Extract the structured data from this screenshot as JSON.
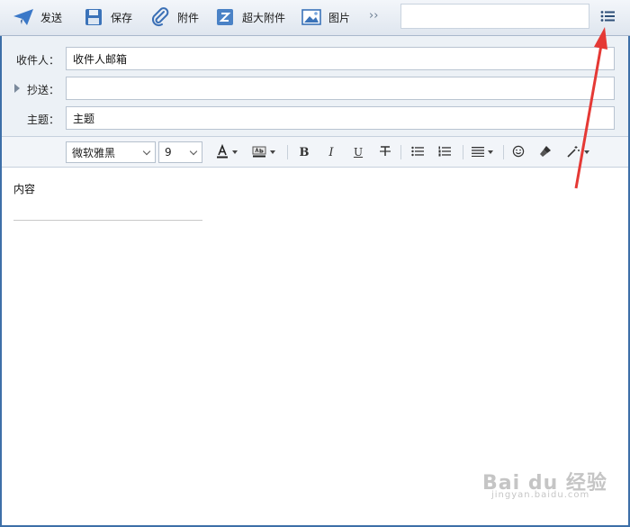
{
  "toolbar": {
    "send": "发送",
    "save": "保存",
    "attach": "附件",
    "big_attach": "超大附件",
    "image": "图片",
    "more": "››",
    "search_value": ""
  },
  "fields": {
    "to_label": "收件人：",
    "to_value": "收件人邮箱",
    "cc_label": "抄送：",
    "cc_value": "",
    "subject_label": "主题：",
    "subject_value": "主题"
  },
  "format": {
    "font_family": "微软雅黑",
    "font_size": "9"
  },
  "body": {
    "content": "内容"
  },
  "watermark": {
    "brand": "Bai du 经验",
    "url": "jingyan.baidu.com"
  },
  "colors": {
    "accent": "#3d6fa8",
    "annotation": "#e53935"
  }
}
